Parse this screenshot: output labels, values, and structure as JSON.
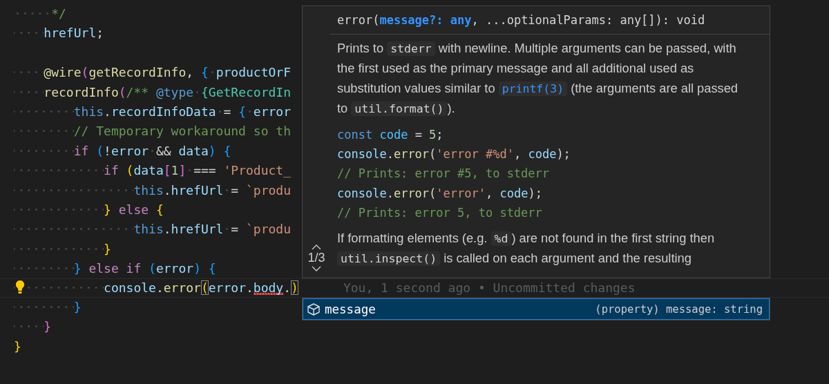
{
  "editor": {
    "lines": [
      {
        "kind": "code",
        "current": false,
        "lightbulb": false,
        "tokens": [
          {
            "kind": "comment",
            "text": "     */"
          }
        ]
      },
      {
        "kind": "code",
        "current": false,
        "lightbulb": false,
        "tokens": [
          {
            "kind": "var",
            "text": "    hrefUrl"
          },
          {
            "kind": "punct",
            "text": ";"
          }
        ]
      },
      {
        "kind": "blank"
      },
      {
        "kind": "code",
        "current": false,
        "lightbulb": false,
        "tokens": [
          {
            "kind": "func",
            "text": "    @wire"
          },
          {
            "kind": "brace2",
            "text": "("
          },
          {
            "kind": "func",
            "text": "getRecordInfo"
          },
          {
            "kind": "punct",
            "text": ", "
          },
          {
            "kind": "brace3",
            "text": "{"
          },
          {
            "kind": "var",
            "text": " productOrF"
          }
        ]
      },
      {
        "kind": "code",
        "current": false,
        "lightbulb": false,
        "tokens": [
          {
            "kind": "func",
            "text": "    recordInfo"
          },
          {
            "kind": "brace2",
            "text": "("
          },
          {
            "kind": "comment",
            "text": "/** "
          },
          {
            "kind": "this",
            "text": "@type"
          },
          {
            "kind": "type",
            "text": " {GetRecordIn"
          }
        ]
      },
      {
        "kind": "code",
        "current": false,
        "lightbulb": false,
        "tokens": [
          {
            "kind": "this",
            "text": "        this"
          },
          {
            "kind": "punct",
            "text": "."
          },
          {
            "kind": "var",
            "text": "recordInfoData"
          },
          {
            "kind": "punct",
            "text": " = "
          },
          {
            "kind": "brace3",
            "text": "{"
          },
          {
            "kind": "var",
            "text": " error"
          }
        ]
      },
      {
        "kind": "code",
        "current": false,
        "lightbulb": false,
        "tokens": [
          {
            "kind": "comment",
            "text": "        // Temporary workaround so th"
          }
        ]
      },
      {
        "kind": "code",
        "current": false,
        "lightbulb": false,
        "tokens": [
          {
            "kind": "keyword",
            "text": "        if "
          },
          {
            "kind": "brace3",
            "text": "("
          },
          {
            "kind": "punct",
            "text": "!"
          },
          {
            "kind": "var",
            "text": "error"
          },
          {
            "kind": "punct",
            "text": " && "
          },
          {
            "kind": "var",
            "text": "data"
          },
          {
            "kind": "brace3",
            "text": ") {"
          }
        ]
      },
      {
        "kind": "code",
        "current": false,
        "lightbulb": false,
        "tokens": [
          {
            "kind": "keyword",
            "text": "            if "
          },
          {
            "kind": "brace1",
            "text": "("
          },
          {
            "kind": "var",
            "text": "data"
          },
          {
            "kind": "brace2",
            "text": "["
          },
          {
            "kind": "number",
            "text": "1"
          },
          {
            "kind": "brace2",
            "text": "]"
          },
          {
            "kind": "punct",
            "text": " === "
          },
          {
            "kind": "string",
            "text": "'Product_"
          }
        ]
      },
      {
        "kind": "code",
        "current": false,
        "lightbulb": false,
        "tokens": [
          {
            "kind": "this",
            "text": "                this"
          },
          {
            "kind": "punct",
            "text": "."
          },
          {
            "kind": "var",
            "text": "hrefUrl"
          },
          {
            "kind": "punct",
            "text": " = "
          },
          {
            "kind": "string",
            "text": "`produ"
          }
        ]
      },
      {
        "kind": "code",
        "current": false,
        "lightbulb": false,
        "tokens": [
          {
            "kind": "brace1",
            "text": "            } "
          },
          {
            "kind": "keyword",
            "text": "else "
          },
          {
            "kind": "brace1",
            "text": "{"
          }
        ]
      },
      {
        "kind": "code",
        "current": false,
        "lightbulb": false,
        "tokens": [
          {
            "kind": "this",
            "text": "                this"
          },
          {
            "kind": "punct",
            "text": "."
          },
          {
            "kind": "var",
            "text": "hrefUrl"
          },
          {
            "kind": "punct",
            "text": " = "
          },
          {
            "kind": "string",
            "text": "`produ"
          }
        ]
      },
      {
        "kind": "code",
        "current": false,
        "lightbulb": false,
        "tokens": [
          {
            "kind": "brace1",
            "text": "            }"
          }
        ]
      },
      {
        "kind": "code",
        "current": false,
        "lightbulb": false,
        "tokens": [
          {
            "kind": "brace3",
            "text": "        } "
          },
          {
            "kind": "keyword",
            "text": "else if "
          },
          {
            "kind": "brace3",
            "text": "("
          },
          {
            "kind": "var",
            "text": "error"
          },
          {
            "kind": "brace3",
            "text": ") {"
          }
        ]
      },
      {
        "kind": "code",
        "current": true,
        "lightbulb": true,
        "blame": "You, 1 second ago • Uncommitted changes",
        "tokens": [
          {
            "kind": "var",
            "text": "            console",
            "matched": false,
            "squiggle": false
          },
          {
            "kind": "punct",
            "text": ".",
            "matched": false,
            "squiggle": false
          },
          {
            "kind": "func",
            "text": "error",
            "matched": false,
            "squiggle": false
          },
          {
            "kind": "brace1",
            "text": "(",
            "matched": true,
            "squiggle": false
          },
          {
            "kind": "var",
            "text": "error",
            "matched": false,
            "squiggle": false
          },
          {
            "kind": "punct",
            "text": ".",
            "matched": false,
            "squiggle": false
          },
          {
            "kind": "var",
            "text": "body",
            "matched": false,
            "squiggle": true
          },
          {
            "kind": "punct",
            "text": ".",
            "matched": false,
            "squiggle": false
          },
          {
            "kind": "brace1",
            "text": ")",
            "matched": true,
            "squiggle": false
          }
        ]
      },
      {
        "kind": "code",
        "current": false,
        "lightbulb": false,
        "tokens": [
          {
            "kind": "brace3",
            "text": "        }"
          }
        ]
      },
      {
        "kind": "code",
        "current": false,
        "lightbulb": false,
        "tokens": [
          {
            "kind": "brace2",
            "text": "    }"
          }
        ]
      },
      {
        "kind": "code",
        "current": false,
        "lightbulb": false,
        "tokens": [
          {
            "kind": "brace1",
            "text": "}"
          }
        ]
      }
    ]
  },
  "hover": {
    "pager": "1/3",
    "signature": [
      {
        "kind": "plain",
        "text": "error("
      },
      {
        "kind": "active",
        "text": "message?: any"
      },
      {
        "kind": "plain",
        "text": ", ...optionalParams: any[]): void"
      }
    ],
    "blocks": [
      {
        "kind": "paragraph",
        "segments": [
          {
            "kind": "text",
            "text": "Prints to "
          },
          {
            "kind": "code",
            "text": "stderr"
          },
          {
            "kind": "text",
            "text": " with newline. Multiple arguments can be passed, with the first used as the primary message and all additional used as substitution values similar to "
          },
          {
            "kind": "link",
            "text": "printf(3)"
          },
          {
            "kind": "text",
            "text": " (the arguments are all passed to "
          },
          {
            "kind": "code",
            "text": "util.format()"
          },
          {
            "kind": "text",
            "text": ")."
          }
        ]
      },
      {
        "kind": "codeblock",
        "lines": [
          [
            {
              "kind": "this",
              "text": "const "
            },
            {
              "kind": "const",
              "text": "code"
            },
            {
              "kind": "punct",
              "text": " = "
            },
            {
              "kind": "number",
              "text": "5"
            },
            {
              "kind": "punct",
              "text": ";"
            }
          ],
          [
            {
              "kind": "var",
              "text": "console"
            },
            {
              "kind": "punct",
              "text": "."
            },
            {
              "kind": "func",
              "text": "error"
            },
            {
              "kind": "punct",
              "text": "("
            },
            {
              "kind": "string",
              "text": "'error #%d'"
            },
            {
              "kind": "punct",
              "text": ", "
            },
            {
              "kind": "var",
              "text": "code"
            },
            {
              "kind": "punct",
              "text": ");"
            }
          ],
          [
            {
              "kind": "comment",
              "text": "// Prints: error #5, to stderr"
            }
          ],
          [
            {
              "kind": "var",
              "text": "console"
            },
            {
              "kind": "punct",
              "text": "."
            },
            {
              "kind": "func",
              "text": "error"
            },
            {
              "kind": "punct",
              "text": "("
            },
            {
              "kind": "string",
              "text": "'error'"
            },
            {
              "kind": "punct",
              "text": ", "
            },
            {
              "kind": "var",
              "text": "code"
            },
            {
              "kind": "punct",
              "text": ");"
            }
          ],
          [
            {
              "kind": "comment",
              "text": "// Prints: error 5, to stderr"
            }
          ]
        ]
      },
      {
        "kind": "paragraph",
        "segments": [
          {
            "kind": "text",
            "text": "If formatting elements (e.g. "
          },
          {
            "kind": "code",
            "text": "%d"
          },
          {
            "kind": "text",
            "text": ") are not found in the first string then "
          },
          {
            "kind": "code",
            "text": "util.inspect()"
          },
          {
            "kind": "text",
            "text": " is called on each argument and the resulting"
          }
        ]
      }
    ]
  },
  "suggestions": [
    {
      "label": "message",
      "detail": "(property) message: string",
      "selected": true
    }
  ]
}
